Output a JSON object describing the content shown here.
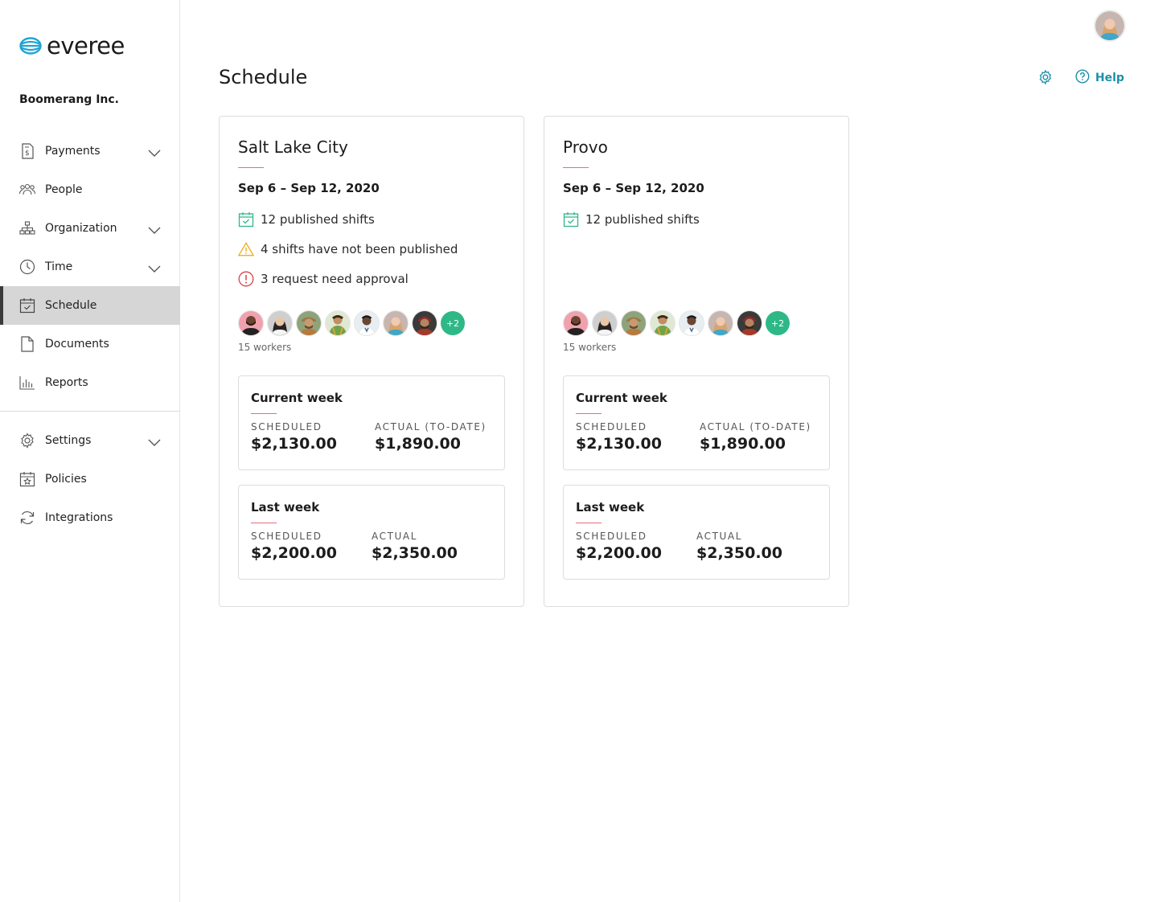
{
  "brand": {
    "name": "everee",
    "accent": "#1fa3d4"
  },
  "company": "Boomerang Inc.",
  "user": {
    "avatar": "user-avatar"
  },
  "nav_primary": [
    {
      "label": "Payments",
      "icon": "receipt-icon",
      "expandable": true
    },
    {
      "label": "People",
      "icon": "people-icon",
      "expandable": false
    },
    {
      "label": "Organization",
      "icon": "org-chart-icon",
      "expandable": true
    },
    {
      "label": "Time",
      "icon": "clock-icon",
      "expandable": true
    },
    {
      "label": "Schedule",
      "icon": "calendar-check-icon",
      "expandable": false,
      "active": true
    },
    {
      "label": "Documents",
      "icon": "document-icon",
      "expandable": false
    },
    {
      "label": "Reports",
      "icon": "bar-chart-icon",
      "expandable": false
    }
  ],
  "nav_secondary": [
    {
      "label": "Settings",
      "icon": "gear-icon",
      "expandable": true
    },
    {
      "label": "Policies",
      "icon": "calendar-star-icon",
      "expandable": false
    },
    {
      "label": "Integrations",
      "icon": "sync-icon",
      "expandable": false
    }
  ],
  "header": {
    "title": "Schedule",
    "help_label": "Help"
  },
  "colors": {
    "teal": "#1e8fa8",
    "green": "#2fb887",
    "warning": "#f0a500",
    "error": "#d9414b",
    "accent_line": "#e0707a"
  },
  "locations": [
    {
      "name": "Salt Lake City",
      "dates": "Sep 6 – Sep 12, 2020",
      "statuses": [
        {
          "type": "published",
          "text": "12 published shifts"
        },
        {
          "type": "warning",
          "text": "4 shifts have not been published"
        },
        {
          "type": "error",
          "text": "3 request need approval"
        }
      ],
      "more_workers": "+2",
      "workers_count": "15 workers",
      "current_week": {
        "title": "Current week",
        "scheduled_label": "Scheduled",
        "scheduled_value": "$2,130.00",
        "actual_label": "Actual (to-date)",
        "actual_value": "$1,890.00"
      },
      "last_week": {
        "title": "Last week",
        "scheduled_label": "Scheduled",
        "scheduled_value": "$2,200.00",
        "actual_label": "Actual",
        "actual_value": "$2,350.00"
      }
    },
    {
      "name": "Provo",
      "dates": "Sep 6 – Sep 12, 2020",
      "statuses": [
        {
          "type": "published",
          "text": "12 published shifts"
        }
      ],
      "more_workers": "+2",
      "workers_count": "15 workers",
      "current_week": {
        "title": "Current week",
        "scheduled_label": "Scheduled",
        "scheduled_value": "$2,130.00",
        "actual_label": "Actual (to-date)",
        "actual_value": "$1,890.00"
      },
      "last_week": {
        "title": "Last week",
        "scheduled_label": "Scheduled",
        "scheduled_value": "$2,200.00",
        "actual_label": "Actual",
        "actual_value": "$2,350.00"
      }
    }
  ]
}
